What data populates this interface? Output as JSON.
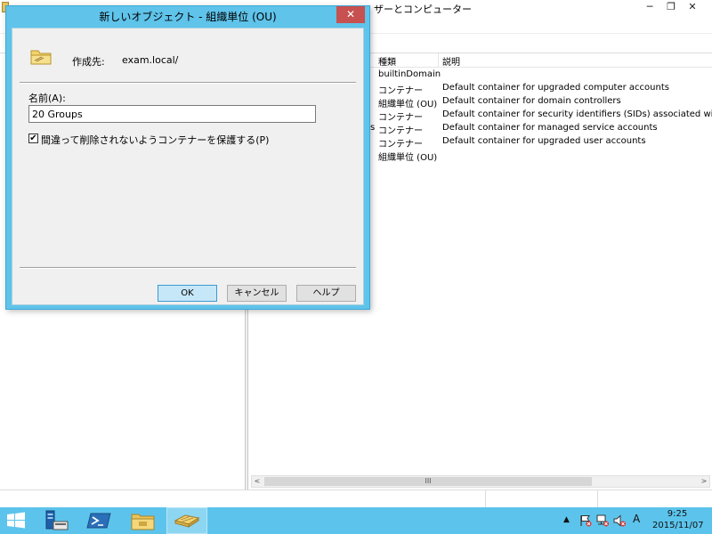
{
  "background_window": {
    "title": "ザーとコンピューター",
    "controls": {
      "minimize": "─",
      "restore": "❐",
      "close": "✕"
    }
  },
  "list": {
    "headers": {
      "type": "種類",
      "description": "説明"
    },
    "rows": [
      {
        "type": "builtinDomain",
        "description": ""
      },
      {
        "type": "コンテナー",
        "description": "Default container for upgraded computer accounts"
      },
      {
        "type": "組織単位 (OU)",
        "description": "Default container for domain controllers"
      },
      {
        "type": "コンテナー",
        "description": "Default container for security identifiers (SIDs) associated with ob"
      },
      {
        "type": "コンテナー",
        "description": "Default container for managed service accounts"
      },
      {
        "type": "コンテナー",
        "description": "Default container for upgraded user accounts"
      },
      {
        "type": "組織単位 (OU)",
        "description": ""
      }
    ],
    "row_edge_fragment": "s",
    "scroll_thumb_label": "III",
    "scroll_left": "<",
    "scroll_right": ">"
  },
  "dialog": {
    "title": "新しいオブジェクト - 組織単位 (OU)",
    "close_label": "✕",
    "create_in_label": "作成先:",
    "create_in_path": "exam.local/",
    "name_label": "名前(A):",
    "name_value": "20 Groups",
    "protect_checkbox_label": "間違って削除されないようコンテナーを保護する(P)",
    "protect_checked": true,
    "check_mark": "✔",
    "buttons": {
      "ok": "OK",
      "cancel": "キャンセル",
      "help": "ヘルプ"
    }
  },
  "taskbar": {
    "tray": {
      "arrow": "▲",
      "ime": "A"
    },
    "clock_time": "9:25",
    "clock_date": "2015/11/07"
  },
  "colors": {
    "dialog_frame": "#5fc3ea",
    "dialog_close": "#c75050",
    "taskbar": "#5cc4ec",
    "default_button": "#c6e7f7"
  },
  "icons": [
    "folder-icon",
    "start-icon",
    "server-manager-icon",
    "powershell-icon",
    "file-explorer-icon",
    "aduc-icon",
    "flag-icon",
    "network-icon",
    "speaker-icon"
  ]
}
